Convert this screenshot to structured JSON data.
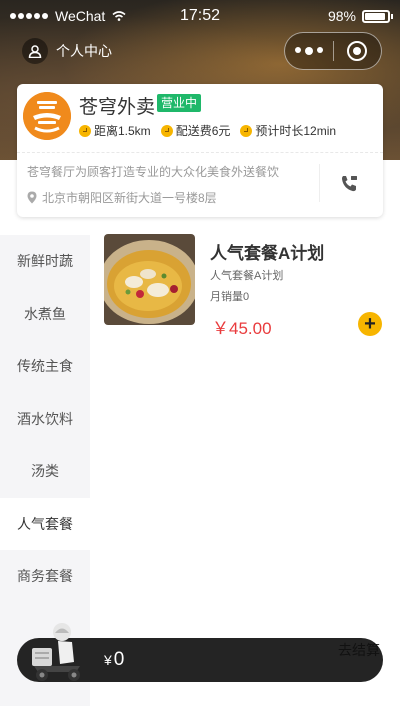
{
  "status_bar": {
    "carrier": "WeChat",
    "time": "17:52",
    "battery": "98%"
  },
  "nav": {
    "personal_center": "个人中心"
  },
  "shop": {
    "name": "苍穹外卖",
    "status_badge": "营业中",
    "distance": "距离1.5km",
    "delivery_fee": "配送费6元",
    "eta": "预计时长12min",
    "description": "苍穹餐厅为顾客打造专业的大众化美食外送餐饮",
    "address": "北京市朝阳区新街大道一号楼8层"
  },
  "categories": [
    {
      "label": "新鲜时蔬",
      "active": false
    },
    {
      "label": "水煮鱼",
      "active": false
    },
    {
      "label": "传统主食",
      "active": false
    },
    {
      "label": "酒水饮料",
      "active": false
    },
    {
      "label": "汤类",
      "active": false
    },
    {
      "label": "人气套餐",
      "active": true
    },
    {
      "label": "商务套餐",
      "active": false
    }
  ],
  "products": [
    {
      "name": "人气套餐A计划",
      "description": "人气套餐A计划",
      "sales": "月销量0",
      "price": "￥45.00"
    }
  ],
  "cart": {
    "currency": "¥",
    "total": "0",
    "checkout_label": "去结算"
  },
  "colors": {
    "accent": "#f7b500",
    "price": "#e93b3d",
    "badge": "#1fb86a",
    "cart_bar": "#242424"
  }
}
